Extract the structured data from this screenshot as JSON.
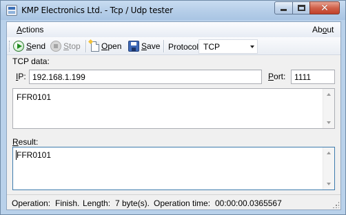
{
  "window": {
    "title": "KMP Electronics Ltd. - Tcp / Udp tester",
    "minimize_icon": "minimize-icon",
    "maximize_icon": "maximize-icon",
    "close_glyph": "✕"
  },
  "menu": {
    "actions": {
      "mnemonic": "A",
      "rest": "ctions"
    },
    "about": {
      "pre": "Ab",
      "mnemonic": "o",
      "post": "ut"
    }
  },
  "toolbar": {
    "send": {
      "mnemonic": "S",
      "rest": "end",
      "icon": "play-icon"
    },
    "stop": {
      "mnemonic": "S",
      "rest": "top",
      "icon": "stop-icon",
      "disabled": true
    },
    "open": {
      "mnemonic": "O",
      "rest": "pen",
      "icon": "open-file-icon"
    },
    "save": {
      "mnemonic": "S",
      "rest": "ave",
      "icon": "floppy-disk-icon"
    },
    "protocol_label": "Protocol:",
    "protocol_value": "TCP"
  },
  "tcp": {
    "section_label": "TCP data:",
    "ip_label_mnemonic": "I",
    "ip_label_rest": "P:",
    "ip_value": "192.168.1.199",
    "port_label_mnemonic": "P",
    "port_label_rest": "ort:",
    "port_value": "1111",
    "data_value": "FFR0101"
  },
  "result": {
    "label_mnemonic": "R",
    "label_rest": "esult:",
    "value": "FFR0101"
  },
  "status": {
    "operation_label": "Operation:",
    "operation_value": "Finish.",
    "length_label": "Length:",
    "length_value": "7 byte(s).",
    "time_label": "Operation time:",
    "time_value": "00:00:00.0365567"
  },
  "colors": {
    "title_bar": "#b7cfe9",
    "close_button": "#d0614a",
    "send_icon": "#1e8c1e",
    "focus_border": "#3d7bad"
  }
}
